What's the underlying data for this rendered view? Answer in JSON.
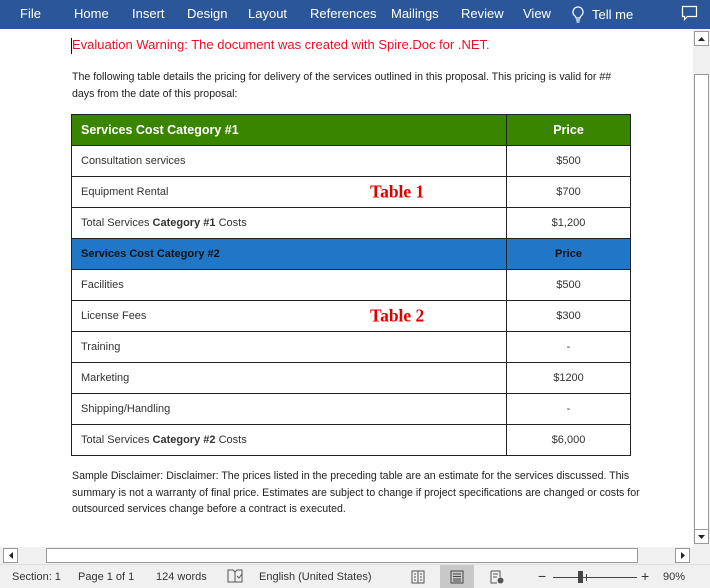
{
  "ribbon": {
    "tabs": [
      "File",
      "Home",
      "Insert",
      "Design",
      "Layout",
      "References",
      "Mailings",
      "Review",
      "View"
    ],
    "tell_me": "Tell me",
    "tell_me_icon": "lightbulb-icon",
    "comment_icon": "comment-icon",
    "color": "#2b579a"
  },
  "document": {
    "warning": "Evaluation Warning: The document was created with Spire.Doc for .NET.",
    "warning_color": "#e81123",
    "intro": "The following table details the pricing for delivery of the services outlined in this proposal. This pricing is valid for ## days from the date of this proposal:",
    "table1": {
      "header": {
        "label": "Services Cost Category #1",
        "price": "Price",
        "color": "#3a8500"
      },
      "overlay_label": "Table 1",
      "rows": [
        {
          "label": "Consultation services",
          "price": "$500"
        },
        {
          "label": "Equipment Rental",
          "price": "$700"
        },
        {
          "label_pre": "Total Services ",
          "label_bold": "Category #1",
          "label_post": " Costs",
          "price": "$1,200"
        }
      ]
    },
    "table2": {
      "header": {
        "label": "Services Cost Category #2",
        "price": "Price",
        "color": "#2177c7"
      },
      "overlay_label": "Table 2",
      "rows": [
        {
          "label": "Facilities",
          "price": "$500"
        },
        {
          "label": "License Fees",
          "price": "$300"
        },
        {
          "label": "Training",
          "price": "-"
        },
        {
          "label": "Marketing",
          "price": "$1200"
        },
        {
          "label": "Shipping/Handling",
          "price": "-"
        },
        {
          "label_pre": "Total Services ",
          "label_bold": "Category #2",
          "label_post": " Costs",
          "price": "$6,000"
        }
      ]
    },
    "disclaimer": "Sample Disclaimer: Disclaimer: The prices listed in the preceding table are an estimate for the services discussed. This summary is not a warranty of final price. Estimates are subject to change if project specifications are changed or costs for outsourced services change before a contract is executed.",
    "overlay_color": "#e00000"
  },
  "status_bar": {
    "section": "Section: 1",
    "page": "Page 1 of 1",
    "words": "124 words",
    "proofing_icon": "proofing-icon",
    "language": "English (United States)",
    "views": [
      "read-mode-icon",
      "print-layout-icon",
      "web-layout-icon"
    ],
    "active_view": "print-layout",
    "zoom_minus": "−",
    "zoom_plus": "+",
    "zoom_level": "90%",
    "zoom_percent": 90
  }
}
